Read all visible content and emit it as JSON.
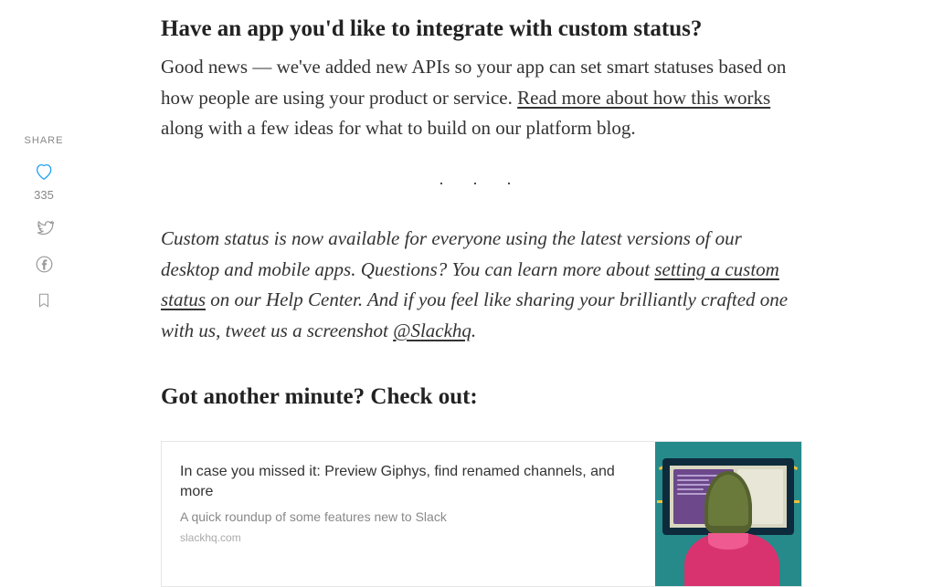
{
  "share": {
    "label": "SHARE",
    "heart_count": "335"
  },
  "content": {
    "h1": "Have an app you'd like to integrate with custom status?",
    "p1_a": "Good news — we've added new APIs so your app can set smart statuses based on how people are using your product or service. ",
    "p1_link": "Read more about how this works",
    "p1_b": " along with a few ideas for what to build on our platform blog.",
    "p2_a": "Custom status is now available for everyone using the latest versions of our desktop and mobile apps. Questions? You can learn more about ",
    "p2_link1": "setting a custom status",
    "p2_b": " on our Help Center. And if you feel like sharing your brilliantly crafted one with us, tweet us a screenshot ",
    "p2_link2": "@Slackhq",
    "p2_c": ".",
    "h2": "Got another minute? Check out:"
  },
  "card": {
    "title": "In case you missed it: Preview Giphys, find renamed channels, and more",
    "subtitle": "A quick roundup of some features new to Slack",
    "domain": "slackhq.com"
  }
}
